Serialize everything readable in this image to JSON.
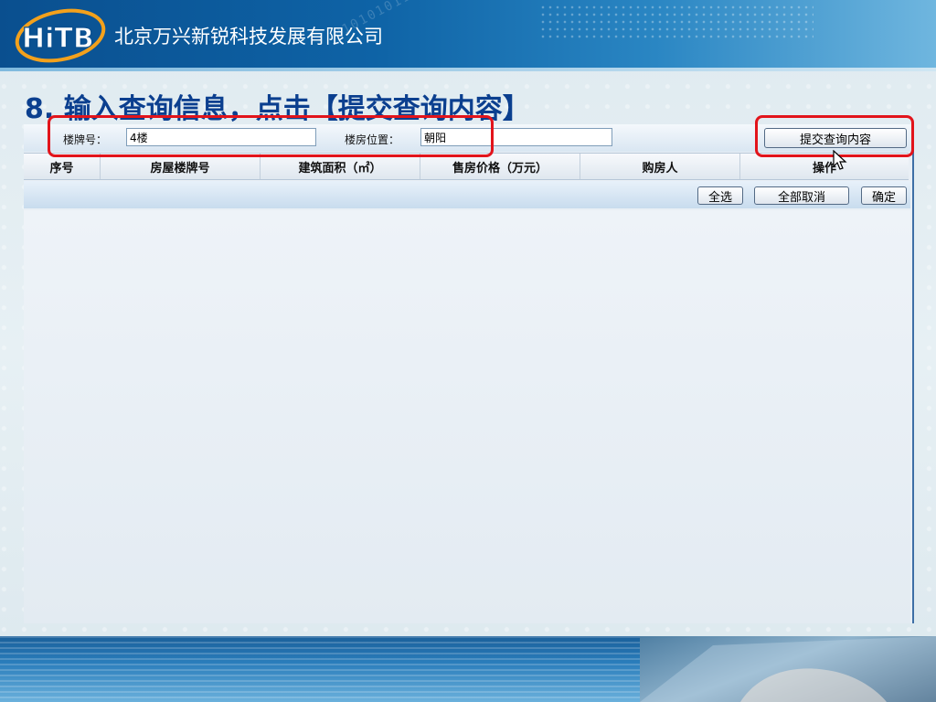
{
  "header": {
    "company_name": "北京万兴新锐科技发展有限公司",
    "logo_text": "HiTB",
    "decor_digits": "0101010110"
  },
  "slide": {
    "step_title": "8. 输入查询信息，点击【提交查询内容】"
  },
  "search": {
    "building_label": "楼牌号：",
    "building_value": "4楼",
    "location_label": "楼房位置：",
    "location_value": "朝阳",
    "submit_label": "提交查询内容"
  },
  "table": {
    "columns": [
      "序号",
      "房屋楼牌号",
      "建筑面积（㎡）",
      "售房价格（万元）",
      "购房人",
      "操作"
    ],
    "rows": []
  },
  "actions": {
    "select_all": "全选",
    "cancel_all": "全部取消",
    "confirm": "确定"
  },
  "colors": {
    "highlight": "#e2141b",
    "title": "#0b3f8f",
    "banner": "#0e63a6"
  }
}
